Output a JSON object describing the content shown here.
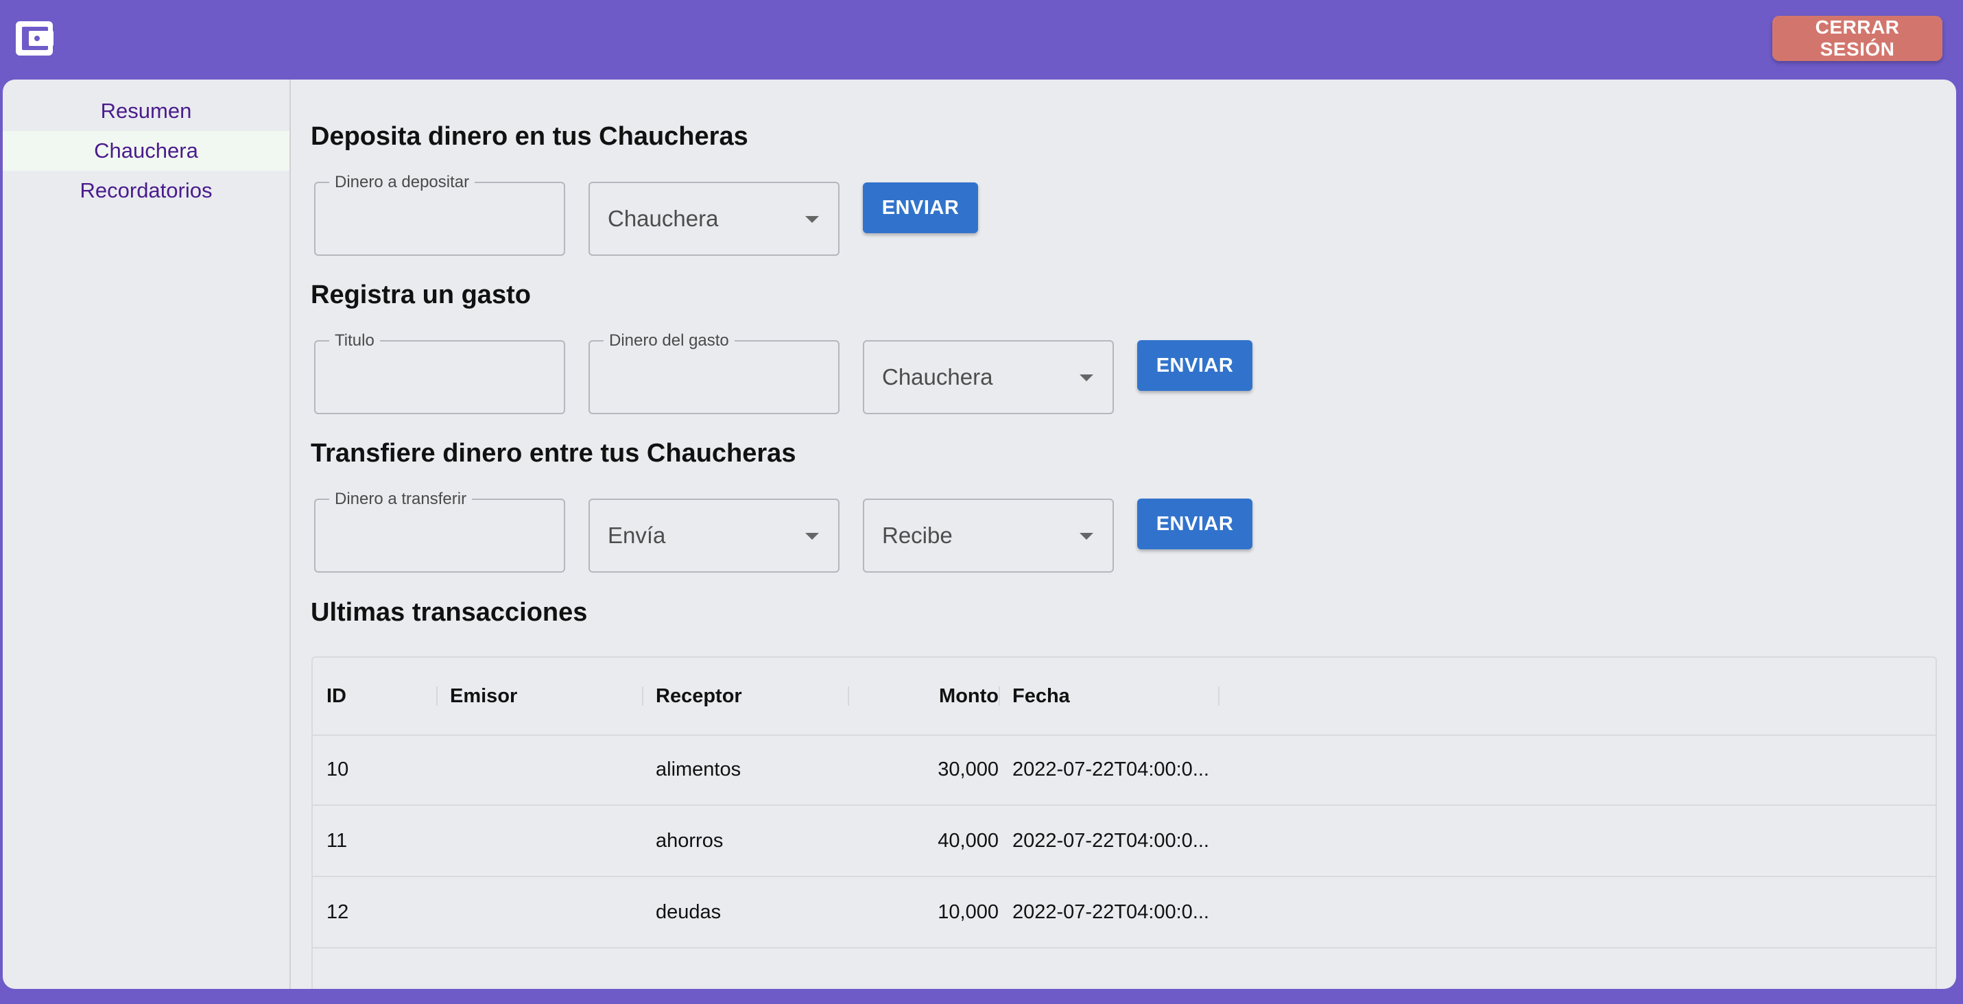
{
  "app": {
    "logo_icon": "wallet-icon",
    "logout_label": "CERRAR SESIÓN"
  },
  "sidebar": {
    "items": [
      {
        "label": "Resumen",
        "active": false
      },
      {
        "label": "Chauchera",
        "active": true
      },
      {
        "label": "Recordatorios",
        "active": false
      }
    ]
  },
  "deposit": {
    "title": "Deposita dinero en tus Chaucheras",
    "amount_label": "Dinero a depositar",
    "amount_value": "",
    "wallet_select": "Chauchera",
    "submit_label": "ENVIAR"
  },
  "expense": {
    "title": "Registra un gasto",
    "title_label": "Titulo",
    "title_value": "",
    "amount_label": "Dinero del gasto",
    "amount_value": "",
    "wallet_select": "Chauchera",
    "submit_label": "ENVIAR"
  },
  "transfer": {
    "title": "Transfiere dinero entre tus Chaucheras",
    "amount_label": "Dinero a transferir",
    "amount_value": "",
    "from_select": "Envía",
    "to_select": "Recibe",
    "submit_label": "ENVIAR"
  },
  "transactions": {
    "title": "Ultimas transacciones",
    "columns": [
      "ID",
      "Emisor",
      "Receptor",
      "Monto",
      "Fecha"
    ],
    "rows": [
      {
        "id": "10",
        "emisor": "",
        "receptor": "alimentos",
        "monto": "30,000",
        "fecha": "2022-07-22T04:00:0..."
      },
      {
        "id": "11",
        "emisor": "",
        "receptor": "ahorros",
        "monto": "40,000",
        "fecha": "2022-07-22T04:00:0..."
      },
      {
        "id": "12",
        "emisor": "",
        "receptor": "deudas",
        "monto": "10,000",
        "fecha": "2022-07-22T04:00:0..."
      }
    ]
  },
  "colors": {
    "appbar": "#6e5bc8",
    "logout_button": "#d2766d",
    "primary_button": "#3173cc",
    "nav_text": "#4a1b8c",
    "panel": "#e9ebef"
  }
}
